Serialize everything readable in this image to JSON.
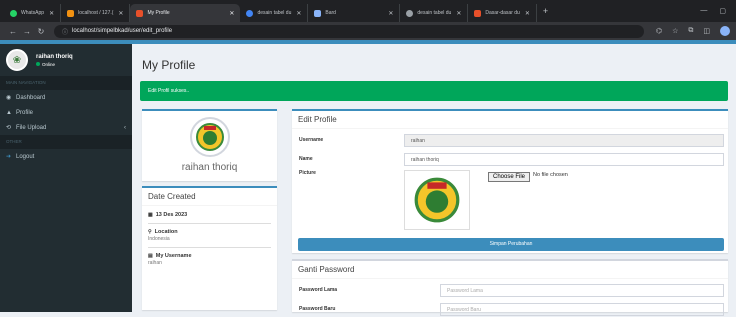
{
  "browser": {
    "tabs": [
      {
        "label": "WhatsApp",
        "color": "#25d366",
        "active": false
      },
      {
        "label": "localhost / 127.(",
        "color": "#f29111",
        "active": false
      },
      {
        "label": "My Profile",
        "color": "#e8502a",
        "active": true
      },
      {
        "label": "desain tabel du",
        "color": "#4285f4",
        "active": false
      },
      {
        "label": "Bard",
        "color": "#8ab4f8",
        "active": false
      },
      {
        "label": "desain tabel du",
        "color": "#9aa0a6",
        "active": false
      },
      {
        "label": "Dasar-dasar du",
        "color": "#e8502a",
        "active": false
      }
    ],
    "url": "localhost/simpelbkad/user/edit_profile"
  },
  "sidebar": {
    "user_name": "raihan thoriq",
    "status": "Online",
    "section_main": "MAIN NAVIGATION",
    "items": [
      {
        "label": "Dashboard",
        "icon": "dashboard-icon"
      },
      {
        "label": "Profile",
        "icon": "user-icon"
      },
      {
        "label": "File Upload",
        "icon": "upload-icon"
      }
    ],
    "section_other": "OTHER",
    "logout": "Logout"
  },
  "page": {
    "title": "My Profile",
    "alert": "Edit Profil sukses.."
  },
  "profile_card": {
    "name": "raihan thoriq"
  },
  "date_card": {
    "title": "Date Created",
    "date": "13 Des 2023",
    "location_label": "Location",
    "location_value": "Indonesia",
    "username_label": "My Username",
    "username_value": "raihan"
  },
  "edit_profile": {
    "title": "Edit Profile",
    "username_label": "Username",
    "username_value": "raihan",
    "name_label": "Name",
    "name_value": "raihan thoriq",
    "picture_label": "Picture",
    "choose_file": "Choose File",
    "no_file": "No file chosen",
    "submit": "Simpan Perubahan"
  },
  "password": {
    "title": "Ganti Password",
    "old_label": "Password Lama",
    "old_placeholder": "Password Lama",
    "new_label": "Password Baru",
    "new_placeholder": "Password Baru"
  },
  "colors": {
    "primary": "#3c8dbc",
    "success": "#00a65a",
    "sidebar": "#222d32"
  }
}
